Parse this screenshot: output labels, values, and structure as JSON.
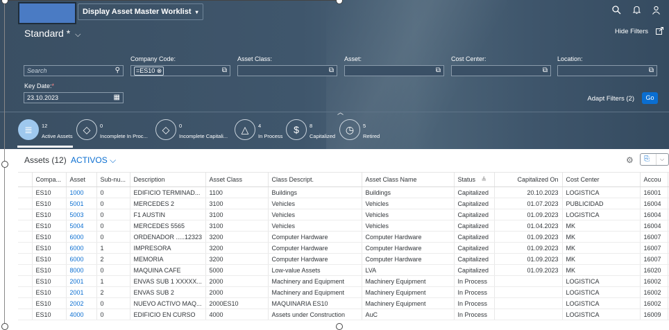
{
  "header": {
    "app_title": "Display Asset Master Worklist",
    "caret": "▾",
    "icons": [
      "search-icon",
      "bell-icon",
      "user-icon"
    ]
  },
  "filterbar": {
    "variant": "Standard *",
    "variant_chevron": "⌵",
    "hide_filters": "Hide Filters",
    "adapt_filters": "Adapt Filters (2)",
    "go": "Go",
    "search_placeholder": "Search",
    "company_code_label": "Company Code:",
    "company_code_token": "=ES10 ⊗",
    "asset_class_label": "Asset Class:",
    "asset_label": "Asset:",
    "cost_center_label": "Cost Center:",
    "location_label": "Location:",
    "key_date_label": "Key Date:",
    "key_date_required": "*",
    "key_date_value": "23.10.2023"
  },
  "tabs": [
    {
      "count": "12",
      "label": "Active Assets",
      "icon": "list-icon",
      "glyph": "≣"
    },
    {
      "count": "0",
      "label": "Incomplete In Proc...",
      "icon": "diamond-icon",
      "glyph": "◇"
    },
    {
      "count": "0",
      "label": "Incomplete Capitali...",
      "icon": "diamond-icon",
      "glyph": "◇"
    },
    {
      "count": "4",
      "label": "In Process",
      "icon": "triangle-icon",
      "glyph": "△"
    },
    {
      "count": "8",
      "label": "Capitalized",
      "icon": "dollar-doc-icon",
      "glyph": "$"
    },
    {
      "count": "5",
      "label": "Retired",
      "icon": "clock-icon",
      "glyph": "◷"
    }
  ],
  "table": {
    "title": "Assets (12)",
    "variant": "ACTIVOS",
    "variant_chevron": "⌵",
    "columns": [
      "Compa...",
      "Asset",
      "Sub-nu...",
      "Description",
      "Asset Class",
      "Class Descript.",
      "Asset Class Name",
      "Status",
      "Capitalized On",
      "Cost Center",
      "Accou"
    ],
    "rows": [
      [
        "ES10",
        "1000",
        "0",
        "EDIFICIO TERMINAD...",
        "1100",
        "Buildings",
        "Buildings",
        "Capitalized",
        "20.10.2023",
        "LOGISTICA",
        "16001"
      ],
      [
        "ES10",
        "5001",
        "0",
        "MERCEDES 2",
        "3100",
        "Vehicles",
        "Vehicles",
        "Capitalized",
        "01.07.2023",
        "PUBLICIDAD",
        "16004"
      ],
      [
        "ES10",
        "5003",
        "0",
        "F1 AUSTIN",
        "3100",
        "Vehicles",
        "Vehicles",
        "Capitalized",
        "01.09.2023",
        "LOGISTICA",
        "16004"
      ],
      [
        "ES10",
        "5004",
        "0",
        "MERCEDES 5565",
        "3100",
        "Vehicles",
        "Vehicles",
        "Capitalized",
        "01.04.2023",
        "MK",
        "16004"
      ],
      [
        "ES10",
        "6000",
        "0",
        "ORDENADOR .....12323",
        "3200",
        "Computer Hardware",
        "Computer Hardware",
        "Capitalized",
        "01.09.2023",
        "MK",
        "16007"
      ],
      [
        "ES10",
        "6000",
        "1",
        "IMPRESORA",
        "3200",
        "Computer Hardware",
        "Computer Hardware",
        "Capitalized",
        "01.09.2023",
        "MK",
        "16007"
      ],
      [
        "ES10",
        "6000",
        "2",
        "MEMORIA",
        "3200",
        "Computer Hardware",
        "Computer Hardware",
        "Capitalized",
        "01.09.2023",
        "MK",
        "16007"
      ],
      [
        "ES10",
        "8000",
        "0",
        "MAQUINA CAFE",
        "5000",
        "Low-value Assets",
        "LVA",
        "Capitalized",
        "01.09.2023",
        "MK",
        "16020"
      ],
      [
        "ES10",
        "2001",
        "1",
        "ENVAS SUB 1 XXXXX...",
        "2000",
        "Machinery and Equipment",
        "Machinery Equipment",
        "In Process",
        "",
        "LOGISTICA",
        "16002"
      ],
      [
        "ES10",
        "2001",
        "2",
        "ENVAS SUB 2",
        "2000",
        "Machinery and Equipment",
        "Machinery Equipment",
        "In Process",
        "",
        "LOGISTICA",
        "16002"
      ],
      [
        "ES10",
        "2002",
        "0",
        "NUEVO ACTIVO MAQ...",
        "2000ES10",
        "MAQUINARIA ES10",
        "Machinery Equipment",
        "In Process",
        "",
        "LOGISTICA",
        "16002"
      ],
      [
        "ES10",
        "4000",
        "0",
        "EDIFICIO EN CURSO",
        "4000",
        "Assets under Construction",
        "AuC",
        "In Process",
        "",
        "LOGISTICA",
        "16009"
      ]
    ]
  }
}
